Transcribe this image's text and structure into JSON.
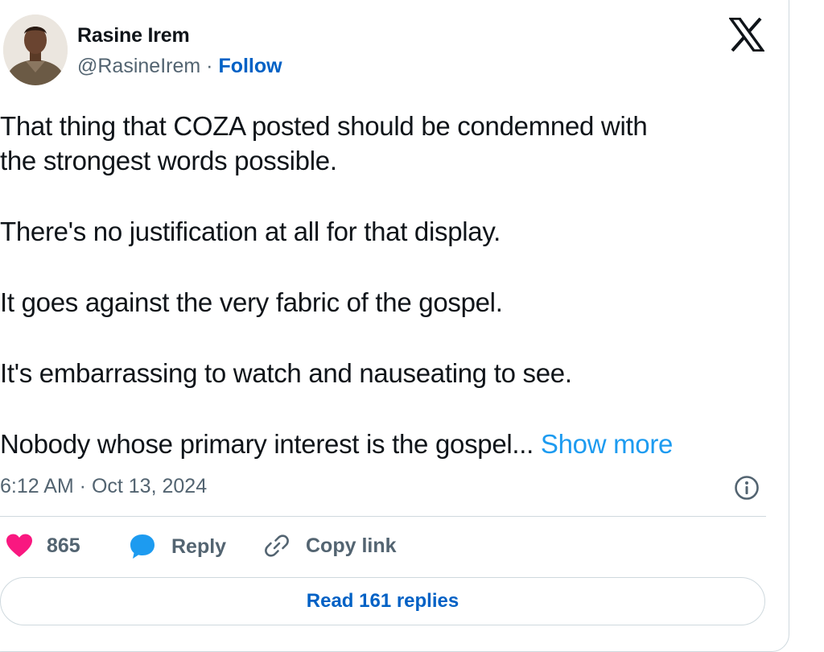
{
  "author": {
    "name": "Rasine Irem",
    "handle": "@RasineIrem",
    "separator": "·",
    "follow_label": "Follow"
  },
  "post": {
    "paragraphs": [
      "That thing that COZA posted should be condemned with",
      "the strongest words possible.",
      "There's no justification at all for that display.",
      "It goes against the very fabric of the gospel.",
      "It's embarrassing to watch and nauseating to see.",
      "Nobody whose primary interest is the gospel..."
    ],
    "show_more_label": "Show more",
    "timestamp": "6:12 AM · Oct 13, 2024"
  },
  "actions": {
    "likes_count": "865",
    "reply_label": "Reply",
    "copy_link_label": "Copy link"
  },
  "read_replies_label": "Read 161 replies",
  "icons": {
    "brand": "x-logo-icon",
    "like": "heart-icon",
    "reply": "speech-bubble-icon",
    "copy": "link-icon",
    "info": "info-icon"
  },
  "colors": {
    "text": "#0f1419",
    "secondary": "#536471",
    "link": "#1d9bf0",
    "follow": "#0061c5",
    "heart": "#f91880",
    "reply": "#1d9bf0",
    "border": "#cfd9de"
  }
}
